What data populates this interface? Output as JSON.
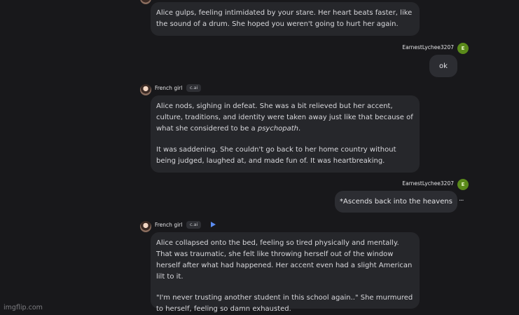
{
  "messages": {
    "m1": {
      "text": "Alice gulps, feeling intimidated by your stare. Her heart beats faster, like the sound of a drum. She hoped you weren't going to hurt her again."
    },
    "u1": {
      "username": "EarnestLychee3207",
      "avatar_letter": "E",
      "text": "ok"
    },
    "m2": {
      "name": "French girl",
      "badge": "c.ai",
      "p1": "Alice nods, sighing in defeat. She was a bit relieved but her accent, culture, traditions, and identity were taken away just like that because of what she considered to be a ",
      "p1_em": "psychopath",
      "p1_end": ".",
      "p2": "It was saddening. She couldn't go back to her home country without being judged, laughed at, and made fun of. It was heartbreaking."
    },
    "u2": {
      "username": "EarnestLychee3207",
      "avatar_letter": "E",
      "text": "*Ascends back into the heavens",
      "more": "···"
    },
    "m3": {
      "name": "French girl",
      "badge": "c.ai",
      "p1": "Alice collapsed onto the bed, feeling so tired physically and mentally. That was traumatic, she felt like throwing herself out of the window herself after what had happened. Her accent even had a slight American lilt to it.",
      "p2": "\"I'm never trusting another student in this school again..\" She murmured to herself, feeling so damn exhausted."
    }
  },
  "watermark": "imgflip.com",
  "colors": {
    "background": "#18181b",
    "bubble": "#26272b",
    "user_avatar": "#5a8a1a",
    "play": "#5b8cf0"
  }
}
